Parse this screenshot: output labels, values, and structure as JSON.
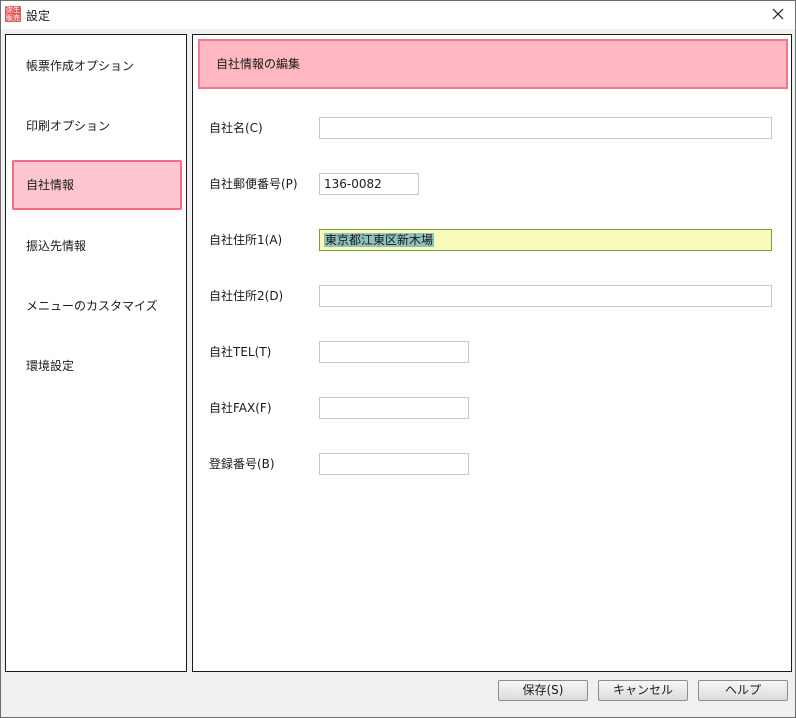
{
  "window": {
    "title": "設定",
    "app_icon_text": [
      "弥生",
      "販売"
    ]
  },
  "sidebar": {
    "items": [
      {
        "label": "帳票作成オプション",
        "active": false
      },
      {
        "label": "印刷オプション",
        "active": false
      },
      {
        "label": "自社情報",
        "active": true
      },
      {
        "label": "振込先情報",
        "active": false
      },
      {
        "label": "メニューのカスタマイズ",
        "active": false
      },
      {
        "label": "環境設定",
        "active": false
      }
    ]
  },
  "main": {
    "header_title": "自社情報の編集",
    "fields": [
      {
        "label": "自社名(C)",
        "value": ""
      },
      {
        "label": "自社郵便番号(P)",
        "value": "136-0082"
      },
      {
        "label": "自社住所1(A)",
        "value": "東京都江東区新木場"
      },
      {
        "label": "自社住所2(D)",
        "value": ""
      },
      {
        "label": "自社TEL(T)",
        "value": ""
      },
      {
        "label": "自社FAX(F)",
        "value": ""
      },
      {
        "label": "登録番号(B)",
        "value": ""
      }
    ]
  },
  "footer": {
    "save_label": "保存(S)",
    "cancel_label": "キャンセル",
    "help_label": "ヘルプ"
  },
  "colors": {
    "active_item_bg": "#ffc6cf",
    "active_item_border": "#f06b83",
    "header_bg": "#ffb7c2",
    "focused_input_bg": "#fafab9",
    "selection_bg": "#8fc1bf"
  },
  "icons": {
    "app": "app-logo-icon",
    "close": "close-icon"
  }
}
